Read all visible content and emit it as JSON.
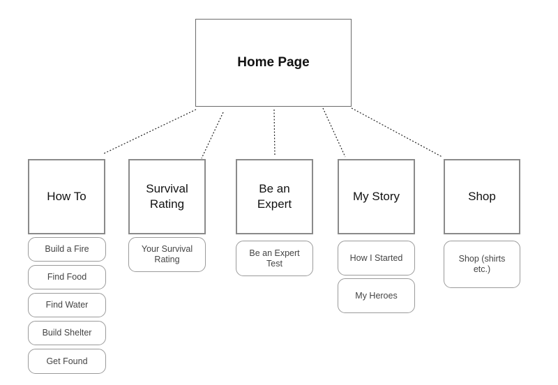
{
  "home": {
    "label": "Home Page"
  },
  "sections": [
    {
      "label": "How To",
      "children": [
        "Build a Fire",
        "Find Food",
        "Find Water",
        "Build Shelter",
        "Get Found"
      ]
    },
    {
      "label": "Survival\nRating",
      "children": [
        "Your Survival\nRating"
      ]
    },
    {
      "label": "Be an\nExpert",
      "children": [
        "Be an Expert\nTest"
      ]
    },
    {
      "label": "My Story",
      "children": [
        "How I Started",
        "My Heroes"
      ]
    },
    {
      "label": "Shop",
      "children": [
        "Shop (shirts\netc.)"
      ]
    }
  ]
}
